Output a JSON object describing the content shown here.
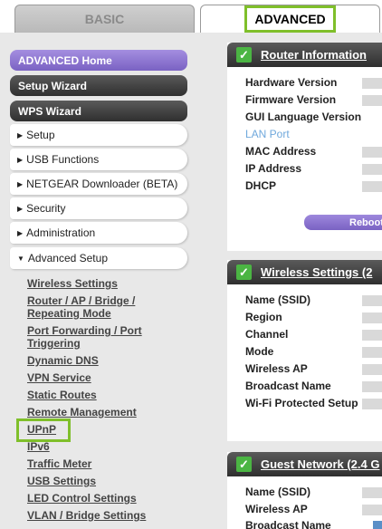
{
  "tabs": {
    "basic": "BASIC",
    "advanced": "ADVANCED"
  },
  "menu": {
    "advanced_home": "ADVANCED Home",
    "setup_wizard": "Setup Wizard",
    "wps_wizard": "WPS Wizard",
    "setup": "Setup",
    "usb_functions": "USB Functions",
    "netgear_downloader": "NETGEAR Downloader (BETA)",
    "security": "Security",
    "administration": "Administration",
    "advanced_setup": "Advanced Setup",
    "submenu": [
      "Wireless Settings",
      "Router / AP / Bridge /",
      "Repeating Mode",
      "Port Forwarding / Port",
      "Triggering",
      "Dynamic DNS",
      "VPN Service",
      "Static Routes",
      "Remote Management",
      "UPnP",
      "IPv6",
      "Traffic Meter",
      "USB Settings",
      "LED Control Settings",
      "VLAN / Bridge Settings"
    ]
  },
  "router_info": {
    "title": "Router Information",
    "rows": [
      "Hardware Version",
      "Firmware Version",
      "GUI Language Version",
      "LAN Port",
      "MAC Address",
      "IP Address",
      "DHCP"
    ],
    "reboot": "Reboot"
  },
  "wireless": {
    "title": "Wireless Settings (2",
    "rows": [
      "Name (SSID)",
      "Region",
      "Channel",
      "Mode",
      "Wireless AP",
      "Broadcast Name",
      "Wi-Fi Protected Setup"
    ]
  },
  "guest": {
    "title": "Guest Network (2.4 G",
    "rows": [
      "Name (SSID)",
      "Wireless AP",
      "Broadcast Name"
    ]
  },
  "colors": {
    "highlight": "#7fbf2a",
    "purple": "#7a62c3",
    "dark": "#2f2f2f",
    "lan_link": "#6fa8dc",
    "check": "#4bb543"
  }
}
